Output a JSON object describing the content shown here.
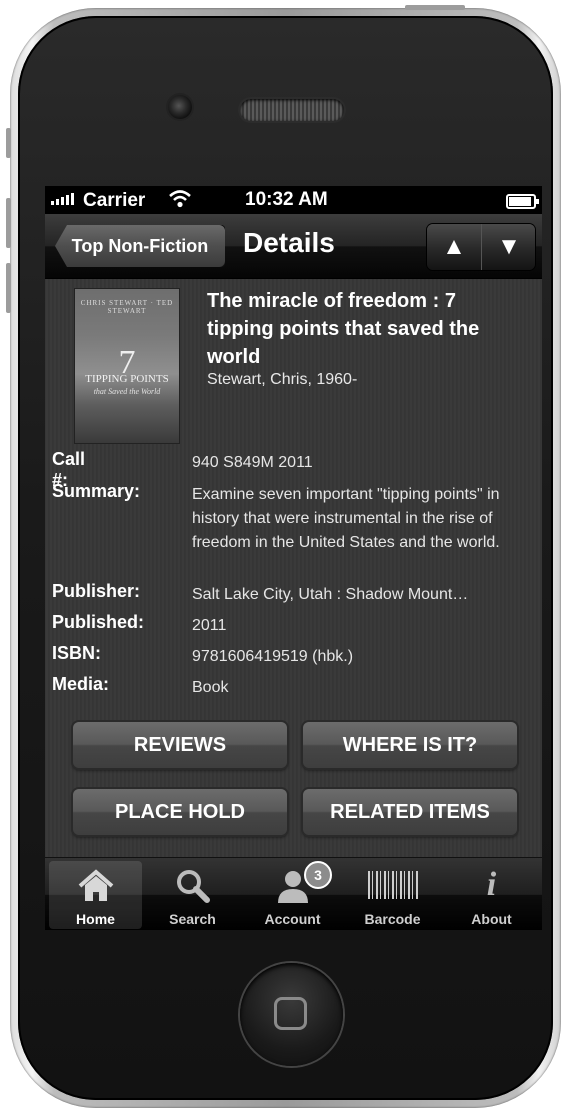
{
  "status_bar": {
    "carrier": "Carrier",
    "time": "10:32 AM",
    "signal_icon": "signal-bars-icon",
    "wifi_icon": "wifi-icon",
    "battery_icon": "battery-icon"
  },
  "nav": {
    "back_label": "Top Non-Fiction",
    "title": "Details",
    "prev_icon": "▲",
    "next_icon": "▼"
  },
  "book": {
    "cover_author": "CHRIS STEWART · TED STEWART",
    "cover_number": "7",
    "cover_title": "TIPPING POINTS",
    "cover_subtitle": "that Saved the World",
    "title": "The miracle of freedom : 7 tipping points that saved the world",
    "author": "Stewart, Chris, 1960-"
  },
  "fields": [
    {
      "label": "Call #:",
      "value": "940 S849M 2011"
    },
    {
      "label": "Summary:",
      "value": "Examine seven important \"tipping points\" in history that were instrumental in the rise of freedom in the United States and the world."
    },
    {
      "label": "Publisher:",
      "value": "Salt Lake City, Utah : Shadow Mount…"
    },
    {
      "label": "Published:",
      "value": "2011"
    },
    {
      "label": "ISBN:",
      "value": "9781606419519 (hbk.)"
    },
    {
      "label": "Media:",
      "value": "Book"
    }
  ],
  "actions": {
    "reviews": "REVIEWS",
    "where_is_it": "WHERE IS IT?",
    "place_hold": "PLACE HOLD",
    "related_items": "RELATED ITEMS"
  },
  "tabs": [
    {
      "label": "Home",
      "icon": "home-icon"
    },
    {
      "label": "Search",
      "icon": "search-icon"
    },
    {
      "label": "Account",
      "icon": "account-icon",
      "badge": "3"
    },
    {
      "label": "Barcode",
      "icon": "barcode-icon"
    },
    {
      "label": "About",
      "icon": "info-icon"
    }
  ]
}
